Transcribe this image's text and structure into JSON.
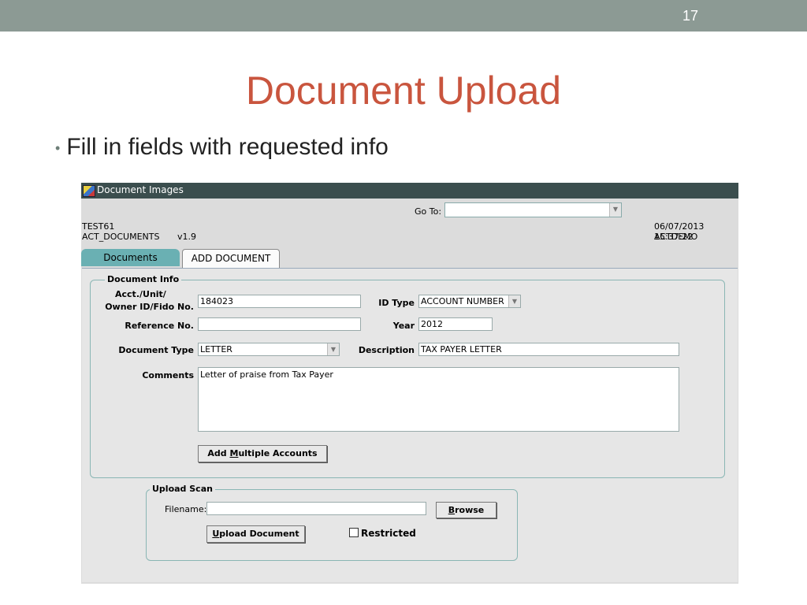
{
  "slide": {
    "number": "17",
    "title": "Document Upload",
    "bullet": "Fill in fields with requested info"
  },
  "window": {
    "title": "Document Images",
    "goto_label": "Go To:",
    "goto_value": "",
    "user_code": "TEST61",
    "form_name": "ACT_DOCUMENTS",
    "version": "v1.9",
    "datetime": "06/07/2013 15:37:22",
    "environment": "ACTDEMO"
  },
  "tabs": [
    {
      "label": "Documents"
    },
    {
      "label": "ADD DOCUMENT"
    }
  ],
  "document_info": {
    "legend": "Document Info",
    "acct_label_1": "Acct./Unit/",
    "acct_label_2": "Owner ID/Fido No.",
    "acct_value": "184023",
    "id_type_label": "ID Type",
    "id_type_value": "ACCOUNT NUMBER",
    "reference_label": "Reference No.",
    "reference_value": "",
    "year_label": "Year",
    "year_value": "2012",
    "doc_type_label": "Document Type",
    "doc_type_value": "LETTER",
    "description_label": "Description",
    "description_value": "TAX PAYER LETTER",
    "comments_label": "Comments",
    "comments_value": "Letter of praise from Tax Payer",
    "add_multiple_pre": "Add ",
    "add_multiple_mnemonic": "M",
    "add_multiple_post": "ultiple Accounts"
  },
  "upload_scan": {
    "legend": "Upload Scan",
    "filename_label": "Filename:",
    "filename_value": "",
    "browse_mnemonic": "B",
    "browse_post": "rowse",
    "upload_mnemonic": "U",
    "upload_post": "pload Document",
    "restricted_label": "Restricted",
    "restricted_checked": false
  }
}
